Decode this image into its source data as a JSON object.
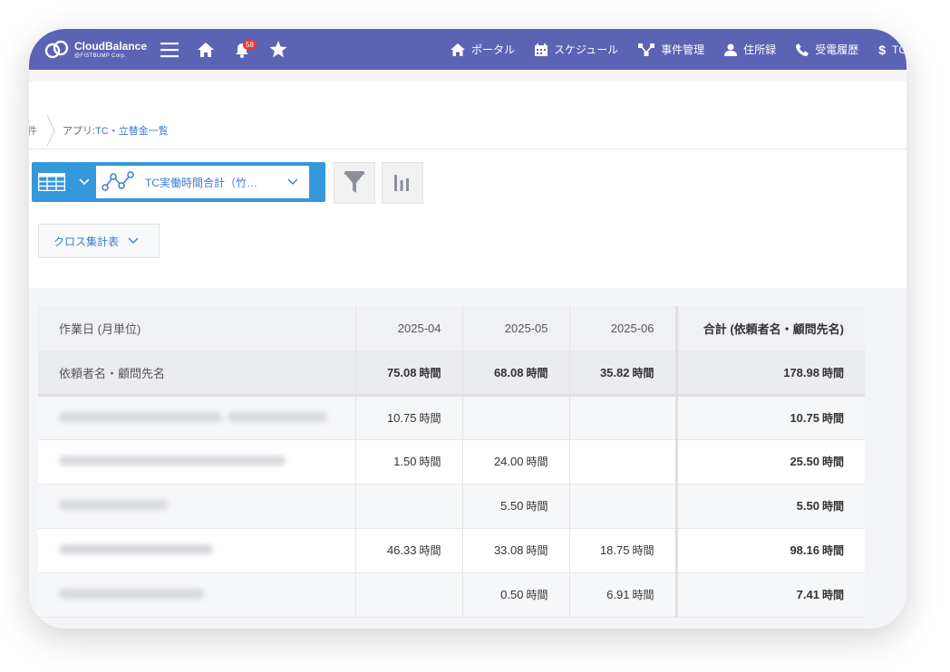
{
  "header": {
    "logo_main": "CloudBalance",
    "logo_sub": "@FISTBUMP Corp.",
    "notification_count": "58",
    "nav": [
      {
        "label": "ポータル",
        "icon": "home-icon"
      },
      {
        "label": "スケジュール",
        "icon": "calendar-icon"
      },
      {
        "label": "事件管理",
        "icon": "network-icon"
      },
      {
        "label": "住所録",
        "icon": "contacts-icon"
      },
      {
        "label": "受電履歴",
        "icon": "phone-icon"
      },
      {
        "label": "TC-",
        "icon": "dollar-icon"
      }
    ]
  },
  "breadcrumb": {
    "prev": "件",
    "app_prefix": "アプリ: ",
    "app_name": "TC・立替金一覧"
  },
  "toolbar": {
    "graph_name": "TC実働時間合計（竹…",
    "cross_label": "クロス集計表"
  },
  "table": {
    "header": {
      "row_label": "作業日 (月単位)",
      "months": [
        "2025-04",
        "2025-05",
        "2025-06"
      ],
      "total": "合計 (依頼者名・顧問先名)"
    },
    "summary": {
      "label": "依頼者名・顧問先名",
      "values": [
        "75.08",
        "68.08",
        "35.82"
      ],
      "total": "178.98"
    },
    "unit": "時間",
    "rows": [
      {
        "values": [
          "10.75",
          "",
          ""
        ],
        "total": "10.75"
      },
      {
        "values": [
          "1.50",
          "24.00",
          ""
        ],
        "total": "25.50"
      },
      {
        "values": [
          "",
          "5.50",
          ""
        ],
        "total": "5.50"
      },
      {
        "values": [
          "46.33",
          "33.08",
          "18.75"
        ],
        "total": "98.16"
      },
      {
        "values": [
          "",
          "0.50",
          "6.91"
        ],
        "total": "7.41"
      }
    ]
  }
}
